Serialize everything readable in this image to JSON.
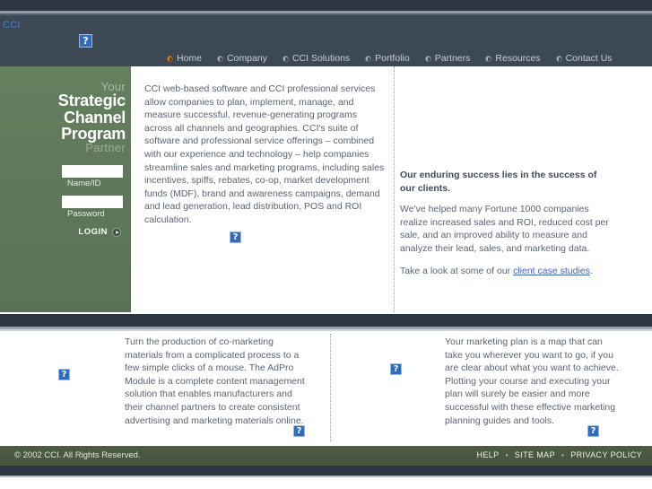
{
  "header": {
    "brand_text": "CCI",
    "logo_icon": "broken-image-icon",
    "nav": [
      {
        "label": "Home",
        "active": true
      },
      {
        "label": "Company",
        "active": false
      },
      {
        "label": "CCI Solutions",
        "active": false
      },
      {
        "label": "Portfolio",
        "active": false
      },
      {
        "label": "Partners",
        "active": false
      },
      {
        "label": "Resources",
        "active": false
      },
      {
        "label": "Contact Us",
        "active": false
      }
    ]
  },
  "sidebar": {
    "tagline_line1": "Your",
    "tagline_line2": "Strategic",
    "tagline_line3": "Channel Program",
    "tagline_line4": "Partner",
    "login": {
      "name_value": "",
      "name_placeholder": "",
      "name_label": "Name/ID",
      "password_value": "",
      "password_placeholder": "",
      "password_label": "Password",
      "submit_label": "LOGIN",
      "submit_icon": "arrow-circle-icon"
    }
  },
  "main": {
    "intro_paragraph": "CCI web-based software and CCI professional services allow companies to plan, implement, manage, and measure successful, revenue-generating programs across all channels and geographies. CCI's suite of software and professional service offerings – combined with our experience and technology – help companies streamline sales and marketing programs, including sales incentives, spiffs, rebates, co-op, market development funds (MDF), brand and awareness campaigns, demand and lead generation, lead distribution, POS and ROI calculation.",
    "success_heading": "Our enduring success lies in the success of our clients.",
    "success_paragraph": " We've helped many Fortune 1000 companies realize increased sales and ROI, reduced cost per sale, and an improved ability to measure and analyze their lead, sales, and marketing data.",
    "case_studies_prefix": "Take a look at some of our ",
    "case_studies_link": "client case studies",
    "case_studies_suffix": "."
  },
  "lower": {
    "adpro_paragraph": "Turn the production of co-marketing materials from a complicated process to a few simple clicks of a mouse. The AdPro Module is a complete content management solution that enables manufacturers and their channel partners to create consistent advertising and marketing materials online.",
    "marketing_paragraph": "Your marketing plan is a map that can take you wherever you want to go, if you are clear about what you want to achieve. Plotting your course and executing your plan will surely be easier and more successful with these effective marketing planning guides and tools."
  },
  "footer": {
    "copyright": "© 2002 CCI. All Rights Reserved.",
    "links": [
      {
        "label": "HELP"
      },
      {
        "label": "SITE MAP"
      },
      {
        "label": "PRIVACY POLICY"
      }
    ],
    "separator": "•"
  },
  "colors": {
    "chrome_dark": "#2b3642",
    "header_bg": "#3d4855",
    "sidebar_green": "#5f7a5c",
    "footer_green": "#48563f",
    "accent_orange": "#e8801a",
    "link_blue": "#3f63c8",
    "body_text": "#5a6472"
  }
}
